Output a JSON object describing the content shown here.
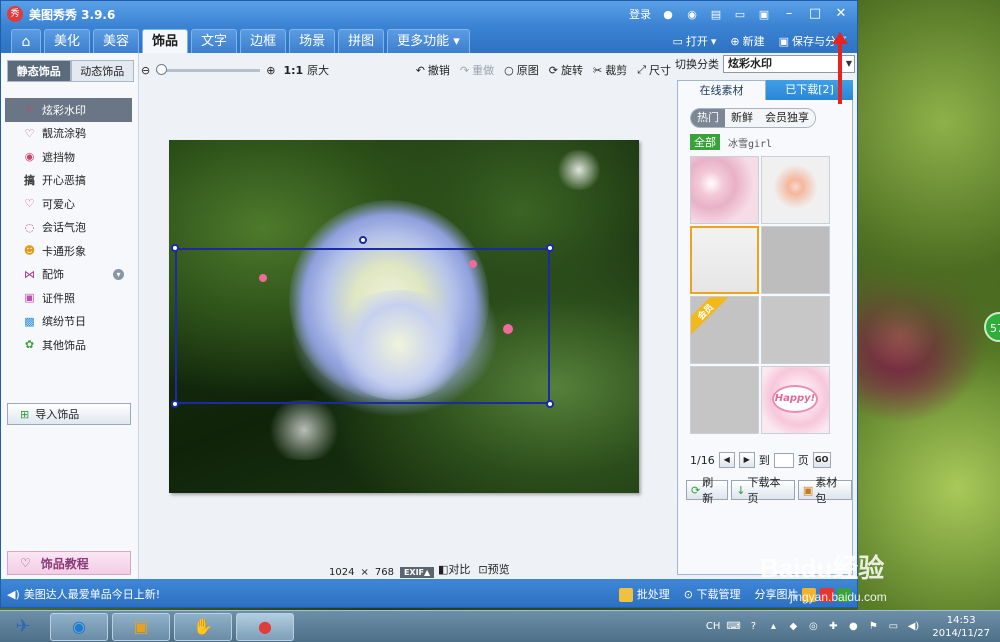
{
  "window": {
    "logo": "秀",
    "title": "美图秀秀 3.9.6",
    "login": "登录"
  },
  "tabs": {
    "home_icon": "home-icon",
    "items": [
      "美化",
      "美容",
      "饰品",
      "文字",
      "边框",
      "场景",
      "拼图",
      "更多功能"
    ],
    "active": "饰品"
  },
  "top_actions": {
    "open": "打开",
    "new": "新建",
    "save": "保存与分享"
  },
  "left_panel": {
    "tab_static": "静态饰品",
    "tab_dynamic": "动态饰品",
    "items": [
      {
        "label": "炫彩水印",
        "icon": "✧"
      },
      {
        "label": "靓流涂鸦",
        "icon": "♡"
      },
      {
        "label": "遮挡物",
        "icon": "◉"
      },
      {
        "label": "开心恶搞",
        "icon": "搞"
      },
      {
        "label": "可爱心",
        "icon": "♡"
      },
      {
        "label": "会话气泡",
        "icon": "◌"
      },
      {
        "label": "卡通形象",
        "icon": "☻"
      },
      {
        "label": "配饰",
        "icon": "⋈"
      },
      {
        "label": "证件照",
        "icon": "▣"
      },
      {
        "label": "缤纷节日",
        "icon": "▩"
      },
      {
        "label": "其他饰品",
        "icon": "✿"
      }
    ],
    "import": "导入饰品",
    "tutorial": "饰品教程"
  },
  "toolbar": {
    "zoom_ratio": "1:1",
    "original_size": "原大",
    "undo": "撤销",
    "redo": "重做",
    "original": "原图",
    "rotate": "旋转",
    "crop": "裁剪",
    "size": "尺寸"
  },
  "canvas": {
    "image_width": "1024",
    "times": "×",
    "image_height": "768",
    "exif": "EXIF▲",
    "compare": "对比",
    "preview": "预览"
  },
  "right_panel": {
    "switch_label": "切换分类",
    "switch_value": "炫彩水印",
    "tab_online": "在线素材",
    "tab_downloaded": "已下载[2]",
    "filters": [
      "热门",
      "新鲜",
      "会员独享"
    ],
    "category_all": "全部",
    "category_user": "冰雪girl",
    "vip_ribbon": "会员",
    "happy_text": "Happy!",
    "page_info": "1/16",
    "goto_label": "到",
    "page_unit": "页",
    "go": "GO",
    "refresh": "刷新",
    "download_page": "下载本页",
    "material_pack": "素材包"
  },
  "status_bar": {
    "message": "美图达人最爱单品今日上新!",
    "batch": "批处理",
    "download_mgr": "下载管理",
    "share_image": "分享图片"
  },
  "desktop": {
    "badge": "57"
  },
  "taskbar": {
    "lang": "CH",
    "time": "14:53",
    "date": "2014/11/27"
  },
  "watermark": {
    "brand": "Baidu经验",
    "url": "jingyan.baidu.com"
  }
}
